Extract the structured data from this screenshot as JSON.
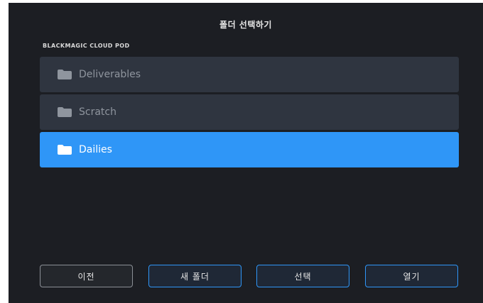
{
  "dialog": {
    "title": "폴더 선택하기",
    "location_label": "BLACKMAGIC CLOUD POD"
  },
  "folders": [
    {
      "label": "Deliverables",
      "selected": false,
      "icon": "folder-icon"
    },
    {
      "label": "Scratch",
      "selected": false,
      "icon": "folder-icon"
    },
    {
      "label": "Dailies",
      "selected": true,
      "icon": "folder-icon"
    }
  ],
  "buttons": {
    "back": "이전",
    "new_folder": "새 폴더",
    "select": "선택",
    "open": "열기"
  },
  "colors": {
    "background": "#1c1e23",
    "row": "#2f3540",
    "selected_row": "#2f96f7",
    "accent_border": "#2f96f7"
  }
}
